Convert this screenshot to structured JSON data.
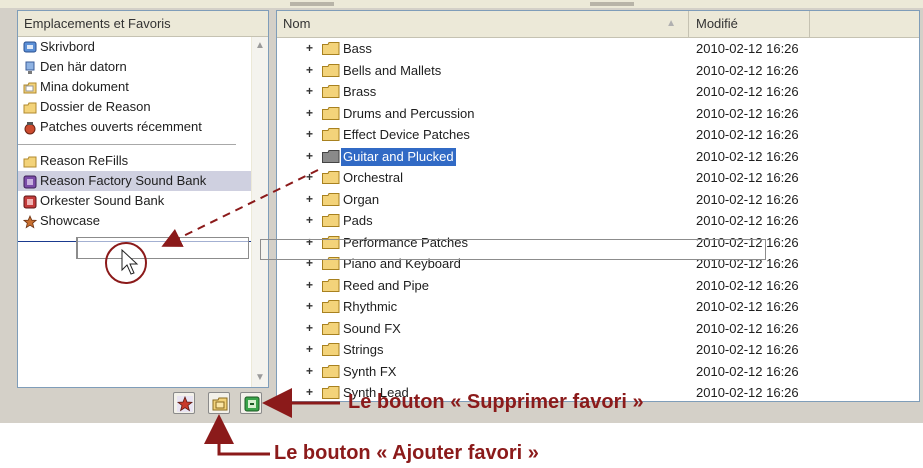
{
  "left_panel": {
    "header": "Emplacements et Favoris",
    "locations": [
      {
        "label": "Skrivbord",
        "icon": "desktop-icon"
      },
      {
        "label": "Den här datorn",
        "icon": "computer-icon"
      },
      {
        "label": "Mina dokument",
        "icon": "documents-folder-icon"
      },
      {
        "label": "Dossier de Reason",
        "icon": "folder-icon"
      },
      {
        "label": "Patches ouverts récemment",
        "icon": "recent-patches-icon"
      }
    ],
    "favorites": [
      {
        "label": "Reason ReFills",
        "icon": "folder-icon"
      },
      {
        "label": "Reason Factory Sound Bank",
        "icon": "refill-purple-icon"
      },
      {
        "label": "Orkester Sound Bank",
        "icon": "refill-red-icon"
      },
      {
        "label": "Showcase",
        "icon": "star-icon"
      }
    ]
  },
  "file_list": {
    "columns": {
      "name": "Nom",
      "modified": "Modifié"
    },
    "rows": [
      {
        "name": "Bass",
        "modified": "2010-02-12 16:26"
      },
      {
        "name": "Bells and Mallets",
        "modified": "2010-02-12 16:26"
      },
      {
        "name": "Brass",
        "modified": "2010-02-12 16:26"
      },
      {
        "name": "Drums and Percussion",
        "modified": "2010-02-12 16:26"
      },
      {
        "name": "Effect Device Patches",
        "modified": "2010-02-12 16:26"
      },
      {
        "name": "Guitar and Plucked",
        "modified": "2010-02-12 16:26",
        "selected": true
      },
      {
        "name": "Orchestral",
        "modified": "2010-02-12 16:26"
      },
      {
        "name": "Organ",
        "modified": "2010-02-12 16:26"
      },
      {
        "name": "Pads",
        "modified": "2010-02-12 16:26"
      },
      {
        "name": "Performance Patches",
        "modified": "2010-02-12 16:26"
      },
      {
        "name": "Piano and Keyboard",
        "modified": "2010-02-12 16:26"
      },
      {
        "name": "Reed and Pipe",
        "modified": "2010-02-12 16:26"
      },
      {
        "name": "Rhythmic",
        "modified": "2010-02-12 16:26"
      },
      {
        "name": "Sound FX",
        "modified": "2010-02-12 16:26"
      },
      {
        "name": "Strings",
        "modified": "2010-02-12 16:26"
      },
      {
        "name": "Synth FX",
        "modified": "2010-02-12 16:26"
      },
      {
        "name": "Synth Lead",
        "modified": "2010-02-12 16:26"
      }
    ]
  },
  "annotations": {
    "remove_favorite": "Le bouton « Supprimer favori »",
    "add_favorite": "Le bouton « Ajouter favori »"
  },
  "colors": {
    "selection": "#316ac5",
    "annotation": "#8b1a1a",
    "folder": "#f3d37a"
  }
}
